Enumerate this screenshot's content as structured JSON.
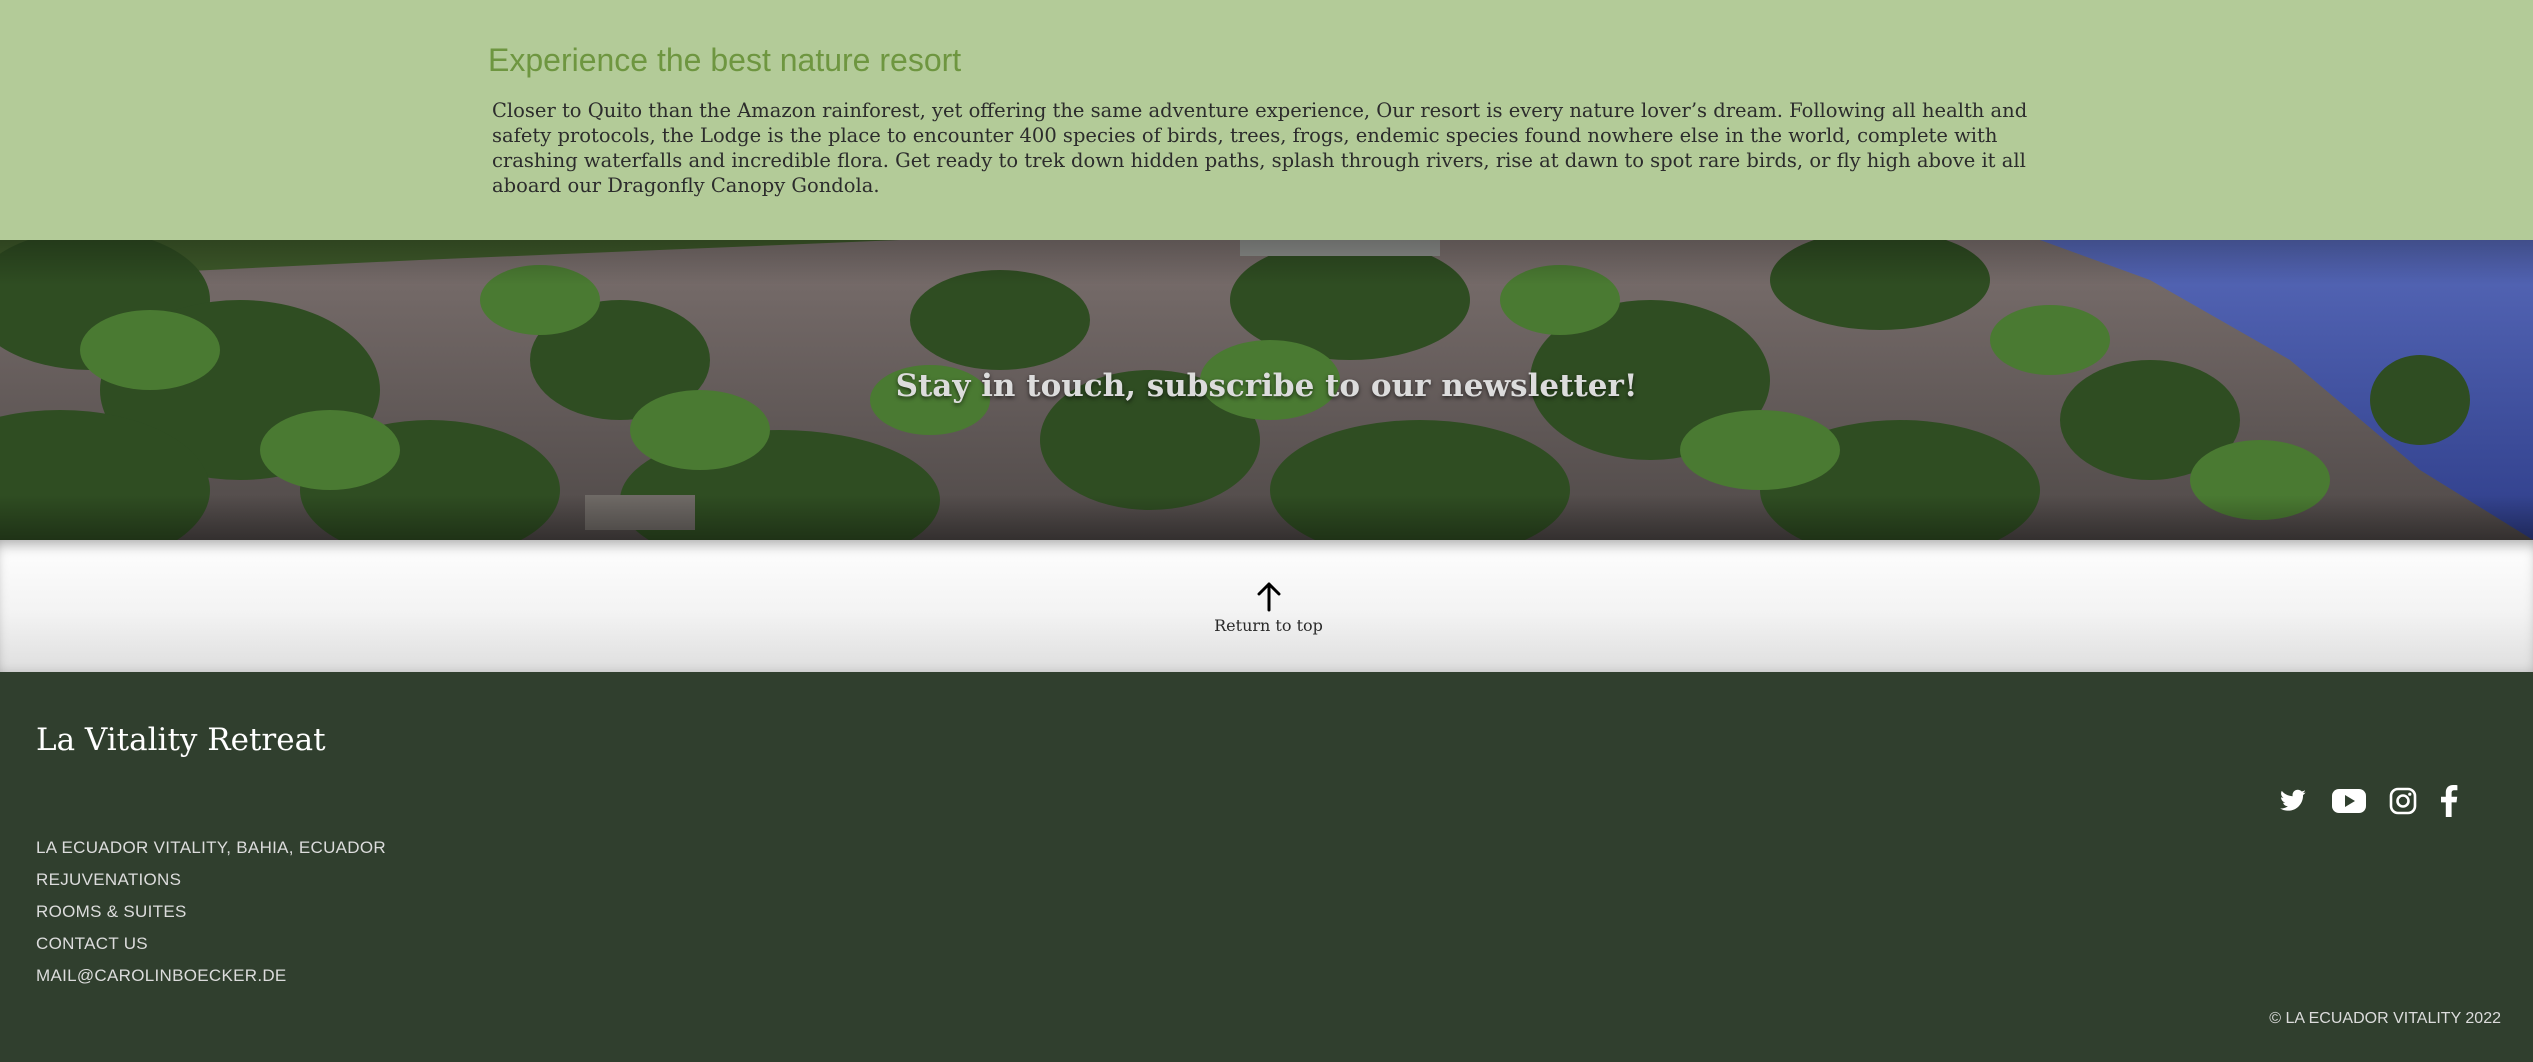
{
  "intro": {
    "title": "Experience the best nature resort",
    "body": "Closer to Quito than the Amazon rainforest, yet offering the same adventure experience, Our resort is every nature lover’s dream. Following all health and safety protocols, the Lodge is the place to encounter 400 species of birds, trees, frogs, endemic species found nowhere else in the world, complete with crashing waterfalls and incredible flora. Get ready to trek down hidden paths, splash through rivers, rise at dawn to spot rare birds, or fly high above it all aboard our Dragonfly Canopy Gondola."
  },
  "newsletter": {
    "text": "Stay in touch, subscribe to our newsletter!"
  },
  "return_to_top": {
    "label": "Return to top",
    "icon": "arrow-up-icon"
  },
  "footer": {
    "brand": "La Vitality Retreat",
    "links": [
      "LA ECUADOR VITALITY, BAHIA, ECUADOR",
      "REJUVENATIONS",
      "ROOMS & SUITES",
      "CONTACT US",
      "MAIL@CAROLINBOECKER.DE"
    ],
    "social": [
      "twitter-icon",
      "youtube-icon",
      "instagram-icon",
      "facebook-icon"
    ],
    "copyright": "© LA ECUADOR VITALITY 2022"
  },
  "colors": {
    "intro_background": "#b3cb98",
    "intro_title": "#6e9640",
    "footer_background": "#303f2e",
    "footer_text": "#dcdcdc"
  }
}
